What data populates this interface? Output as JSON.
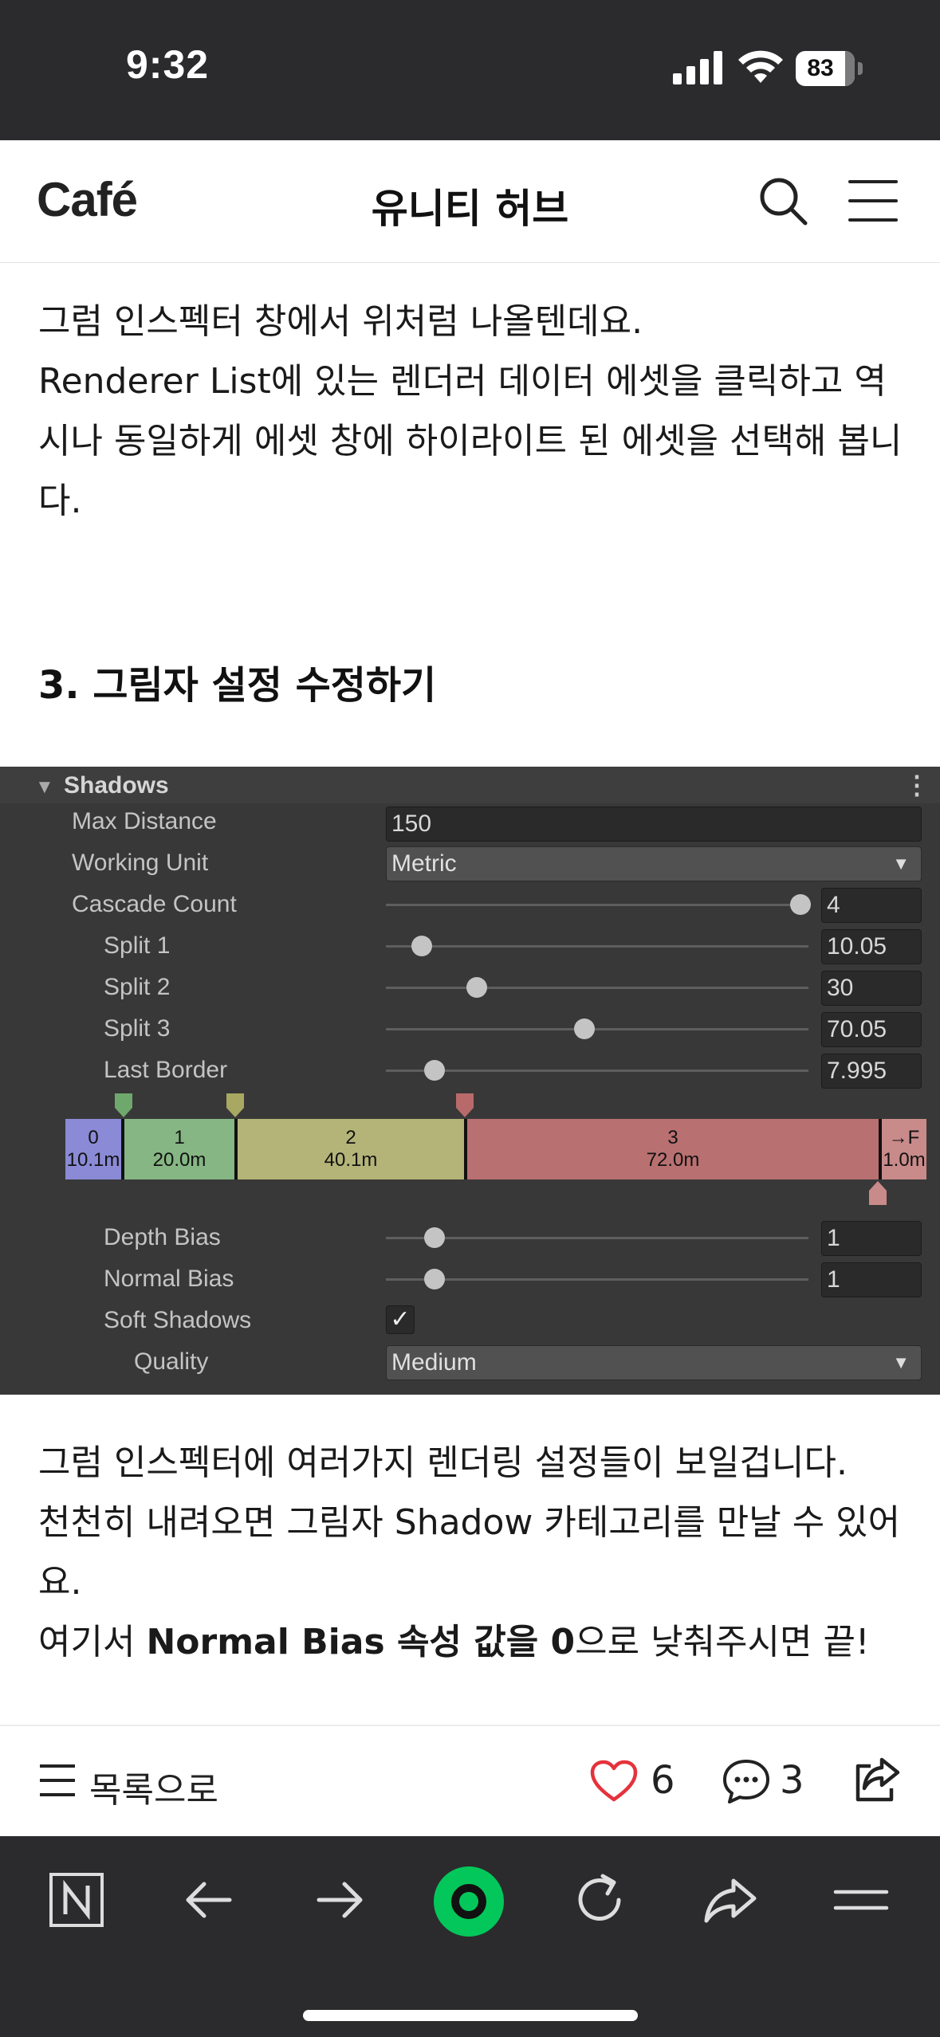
{
  "status_bar": {
    "time": "9:32",
    "battery": "83"
  },
  "header": {
    "logo": "Café",
    "title": "유니티 허브"
  },
  "article": {
    "paragraph1": "그럼 인스펙터 창에서 위처럼 나올텐데요.\nRenderer List에 있는 렌더러 데이터 에셋을 클릭하고 역시나 동일하게 에셋 창에 하이라이트 된 에셋을 선택해 봅니다.",
    "heading": "3. 그림자 설정 수정하기",
    "paragraph2_line1": "그럼 인스펙터에 여러가지 렌더링 설정들이 보일겁니다.",
    "paragraph2_line2": "천천히 내려오면 그림자 Shadow 카테고리를 만날 수 있어요.",
    "paragraph2_line3_pre": "여기서 ",
    "paragraph2_line3_bold": "Normal Bias 속성 값을 0",
    "paragraph2_line3_post": "으로 낮춰주시면 끝!"
  },
  "inspector": {
    "section_title": "Shadows",
    "max_distance_label": "Max Distance",
    "max_distance_value": "150",
    "working_unit_label": "Working Unit",
    "working_unit_value": "Metric",
    "cascade_count_label": "Cascade Count",
    "cascade_count_value": "4",
    "cascade_count_level": 1.0,
    "split1_label": "Split 1",
    "split1_value": "10.05",
    "split1_level": 0.085,
    "split2_label": "Split 2",
    "split2_value": "30",
    "split2_level": 0.215,
    "split3_label": "Split 3",
    "split3_value": "70.05",
    "split3_level": 0.47,
    "last_border_label": "Last Border",
    "last_border_value": "7.995",
    "last_border_level": 0.115,
    "cascade_segments": [
      {
        "index": "0",
        "distance": "10.1m",
        "color": "#8a8ad6"
      },
      {
        "index": "1",
        "distance": "20.0m",
        "color": "#85b683"
      },
      {
        "index": "2",
        "distance": "40.1m",
        "color": "#b4b478"
      },
      {
        "index": "3",
        "distance": "72.0m",
        "color": "#b97070"
      },
      {
        "index": "→F",
        "distance": "1.0m",
        "color": "#c98a8a"
      }
    ],
    "depth_bias_label": "Depth Bias",
    "depth_bias_value": "1",
    "depth_bias_level": 0.115,
    "normal_bias_label": "Normal Bias",
    "normal_bias_value": "1",
    "normal_bias_level": 0.115,
    "soft_shadows_label": "Soft Shadows",
    "soft_shadows_checked": "✓",
    "quality_label": "Quality",
    "quality_value": "Medium"
  },
  "post_bar": {
    "list_label": "목록으로",
    "like_count": "6",
    "comment_count": "3"
  },
  "colors": {
    "accent_green": "#03c75a",
    "like_red": "#e5323c"
  }
}
